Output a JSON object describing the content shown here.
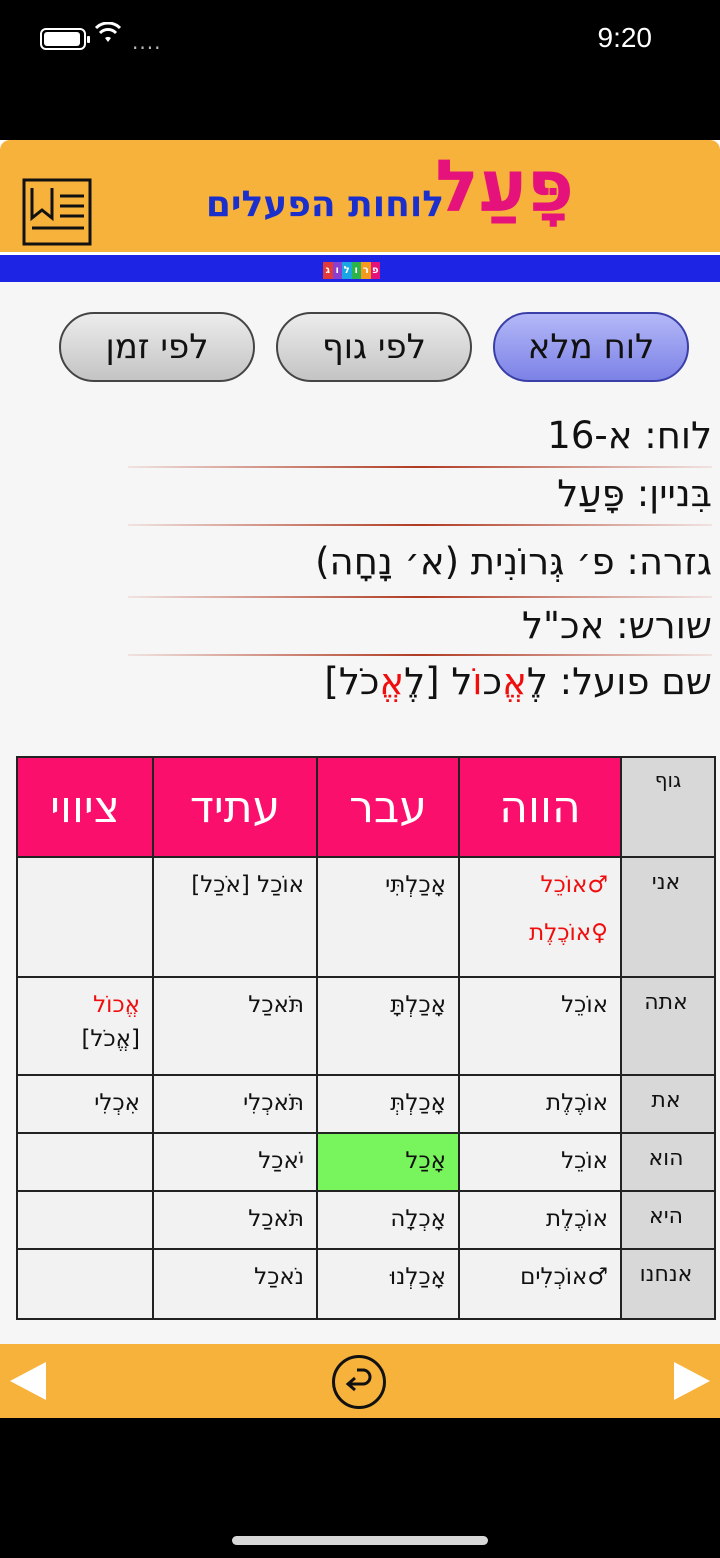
{
  "status_bar": {
    "time": "9:20",
    "signal_dots": "....",
    "wifi_icon": "wifi-icon",
    "battery_icon": "battery-icon"
  },
  "header": {
    "brand": "פָּעַל",
    "subtitle": "לוחות הפעלים",
    "logo_letters": [
      "פ",
      "ר",
      "ו",
      "ל",
      "ו",
      "ג"
    ],
    "logo_colors": [
      "#e6127b",
      "#f59a1c",
      "#2cb34a",
      "#1aa6e0",
      "#8a3fd0",
      "#e23a3a"
    ]
  },
  "tabs": [
    {
      "label": "לוח מלא",
      "active": true
    },
    {
      "label": "לפי גוף",
      "active": false
    },
    {
      "label": "לפי זמן",
      "active": false
    }
  ],
  "info": {
    "board_label": "לוח:",
    "board_value": "א-16",
    "binyan_label": "בִּניין:",
    "binyan_value": "פָּעַל",
    "gizra_label": "גזרה:",
    "gizra_value": "פ׳ גְּרוֹנִית (א׳ נָחָה)",
    "root_label": "שורש:",
    "root_value": "אכ\"ל",
    "infinitive_label": "שם פועל:",
    "infinitive_prefix": "לֶ",
    "infinitive_red1": "אֱ",
    "infinitive_mid1": "כ",
    "infinitive_red2": "וֹ",
    "infinitive_mid2": "ל [לֶ",
    "infinitive_red3": "אֱ",
    "infinitive_end": "כֹל]"
  },
  "table": {
    "headers": {
      "person": "גוף",
      "present": "הווה",
      "past": "עבר",
      "future": "עתיד",
      "imperative": "ציווי"
    },
    "rows": [
      {
        "person": "אני",
        "present": "♂אוֹכֵל",
        "present2": "♀אוֹכֶלֶת",
        "past": "אָכַלְתִּי",
        "future": "אוֹכַל [אֹכַל]",
        "imperative": ""
      },
      {
        "person": "אתה",
        "present": "אוֹכֵל",
        "present2": "",
        "past": "אָכַלְתָּ",
        "future": "תֹּאכַל",
        "imperative": "אֱכוֹל",
        "imperative2": "[אֱכֹל]"
      },
      {
        "person": "את",
        "present": "אוֹכֶלֶת",
        "present2": "",
        "past": "אָכַלְתְּ",
        "future": "תֹּאכְלִי",
        "imperative": "אִכְלִי"
      },
      {
        "person": "הוא",
        "present": "אוֹכֵל",
        "present2": "",
        "past": "אָכַל",
        "future": "יֹאכַל",
        "imperative": ""
      },
      {
        "person": "היא",
        "present": "אוֹכֶלֶת",
        "present2": "",
        "past": "אָכְלָה",
        "future": "תֹּאכַל",
        "imperative": ""
      },
      {
        "person": "אנחנו",
        "present": "♂אוֹכְלִים",
        "present2": "",
        "past": "אָכַלְנוּ",
        "future": "נֹאכַל",
        "imperative": ""
      }
    ]
  },
  "footer": {
    "prev_icon": "triangle-left-icon",
    "back_icon": "undo-icon",
    "next_icon": "triangle-right-icon"
  },
  "colors": {
    "header": "#f6b23a",
    "brand": "#e6127b",
    "subtitle": "#1a2fcc",
    "stripe": "#1d24e3",
    "table_header": "#fa0f6d",
    "highlight": "#78f55c",
    "accent_red": "#f00d0d"
  }
}
